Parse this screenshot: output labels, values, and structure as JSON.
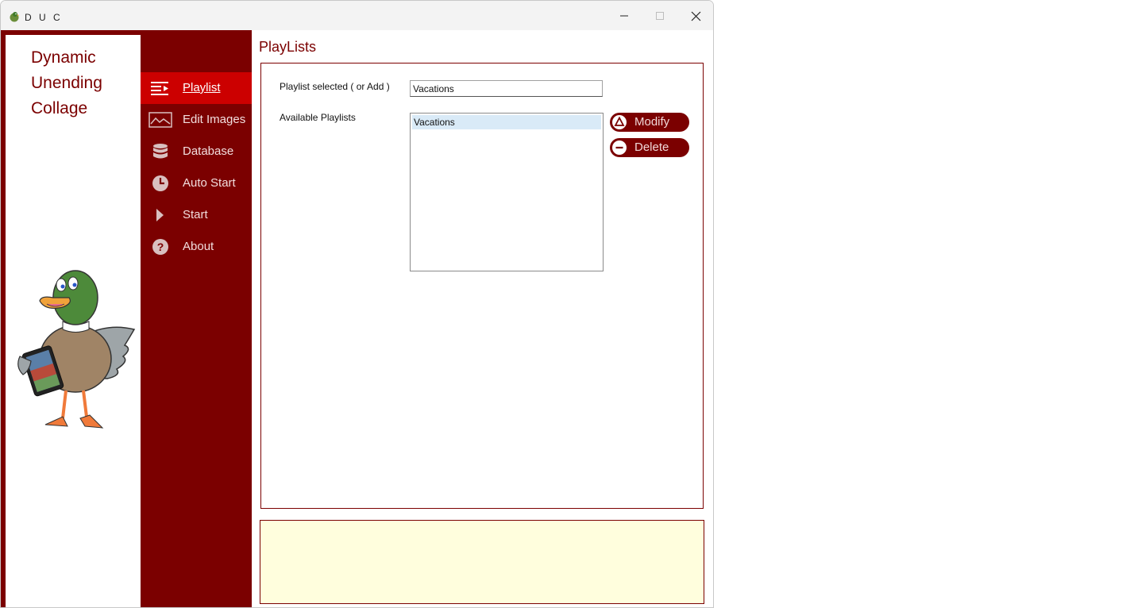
{
  "window": {
    "title": "DUC"
  },
  "titlebar": {
    "minimize_icon": "minimize-icon",
    "maximize_icon": "maximize-icon",
    "close_icon": "close-icon"
  },
  "logo": {
    "lines": [
      "Dynamic",
      "Unending",
      "Collage"
    ]
  },
  "nav": {
    "items": [
      {
        "label": "Playlist",
        "icon": "playlist-icon",
        "active": true
      },
      {
        "label": "Edit Images",
        "icon": "image-icon",
        "active": false
      },
      {
        "label": "Database",
        "icon": "database-icon",
        "active": false
      },
      {
        "label": "Auto Start",
        "icon": "clock-icon",
        "active": false
      },
      {
        "label": "Start",
        "icon": "play-icon",
        "active": false
      },
      {
        "label": "About",
        "icon": "question-icon",
        "active": false
      }
    ]
  },
  "main": {
    "title": "PlayLists",
    "selected_label": "Playlist selected ( or Add )",
    "selected_value": "Vacations",
    "available_label": "Available Playlists",
    "playlists": [
      "Vacations"
    ],
    "modify_label": "Modify",
    "delete_label": "Delete"
  },
  "colors": {
    "brand": "#7b0000",
    "active_nav": "#cc0000",
    "status_bg": "#fffedd",
    "selection": "#d9eaf7"
  }
}
